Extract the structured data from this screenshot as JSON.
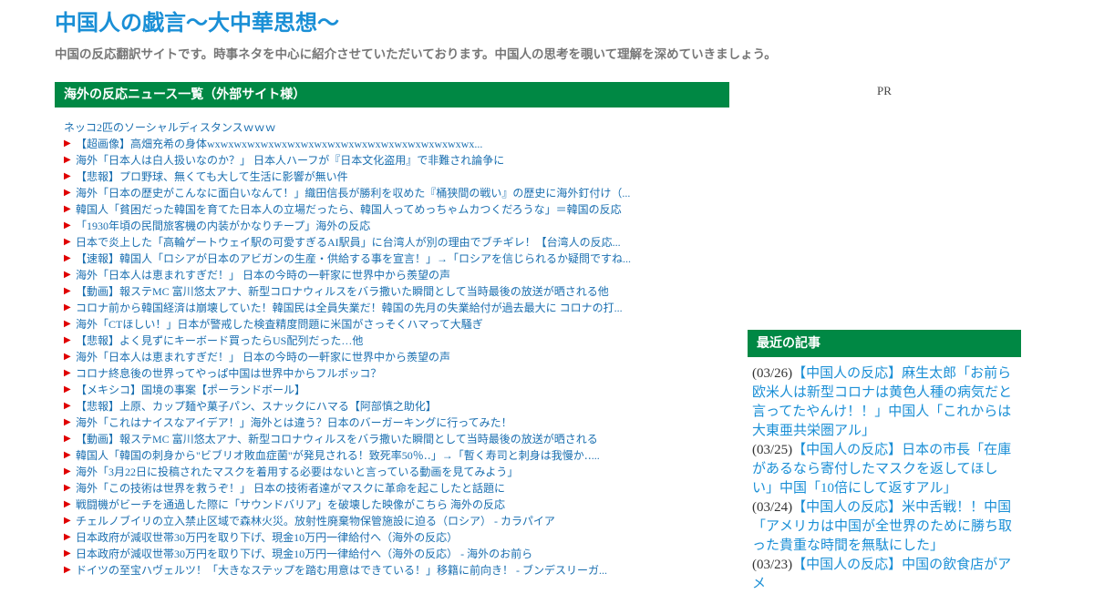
{
  "site": {
    "title": "中国人の戯言～大中華思想～",
    "description": "中国の反応翻訳サイトです。時事ネタを中心に紹介させていただいております。中国人の思考を覗いて理解を深めていきましょう。"
  },
  "news_widget": {
    "header": "海外の反応ニュース一覧（外部サイト様）",
    "items": [
      {
        "arrow": false,
        "text": "ネッコ2匹のソーシャルディスタンスｗｗｗ"
      },
      {
        "arrow": true,
        "text": "【超画像】高畑充希の身体wxwxwxwxwxwxwxwxwxwxwxwxwxwxwxwxwxwxwxwx..."
      },
      {
        "arrow": true,
        "text": "海外「日本人は白人扱いなのか？」 日本人ハーフが『日本文化盗用』で非難され論争に"
      },
      {
        "arrow": true,
        "text": "【悲報】プロ野球、無くても大して生活に影響が無い件"
      },
      {
        "arrow": true,
        "text": "海外「日本の歴史がこんなに面白いなんて！」織田信長が勝利を収めた『桶狭間の戦い』の歴史に海外釘付け（..."
      },
      {
        "arrow": true,
        "text": "韓国人「貧困だった韓国を育てた日本人の立場だったら、韓国人ってめっちゃムカつくだろうな」＝韓国の反応"
      },
      {
        "arrow": true,
        "text": "「1930年頃の民間旅客機の内装がかなりチープ」海外の反応"
      },
      {
        "arrow": true,
        "text": "日本で炎上した「高輪ゲートウェイ駅の可愛すぎるAI駅員」に台湾人が別の理由でブチギレ！【台湾人の反応..."
      },
      {
        "arrow": true,
        "text": "【速報】韓国人「ロシアが日本のアビガンの生産・供給する事を宣言！」→「ロシアを信じられるか疑問ですね..."
      },
      {
        "arrow": true,
        "text": "海外「日本人は恵まれすぎだ！」 日本の今時の一軒家に世界中から羨望の声"
      },
      {
        "arrow": true,
        "text": "【動画】報ステMC 富川悠太アナ、新型コロナウィルスをバラ撒いた瞬間として当時最後の放送が晒される他"
      },
      {
        "arrow": true,
        "text": "コロナ前から韓国経済は崩壊していた！韓国民は全員失業だ！韓国の先月の失業給付が過去最大に コロナの打..."
      },
      {
        "arrow": true,
        "text": "海外「CTほしい！」日本が警戒した検査精度問題に米国がさっそくハマって大騒ぎ"
      },
      {
        "arrow": true,
        "text": "【悲報】よく見ずにキーボード買ったらUS配列だった…他"
      },
      {
        "arrow": true,
        "text": "海外「日本人は恵まれすぎだ！」 日本の今時の一軒家に世界中から羨望の声"
      },
      {
        "arrow": true,
        "text": "コロナ終息後の世界ってやっぱ中国は世界中からフルボッコ？"
      },
      {
        "arrow": true,
        "text": "【メキシコ】国境の事案【ポーランドボール】"
      },
      {
        "arrow": true,
        "text": "【悲報】上原、カップ麺や菓子パン、スナックにハマる【阿部慎之助化】"
      },
      {
        "arrow": true,
        "text": "海外「これはナイスなアイデア！」海外とは違う？日本のバーガーキングに行ってみた！"
      },
      {
        "arrow": true,
        "text": "【動画】報ステMC 富川悠太アナ、新型コロナウィルスをバラ撒いた瞬間として当時最後の放送が晒される"
      },
      {
        "arrow": true,
        "text": "韓国人「韓国の刺身から\"ビブリオ敗血症菌\"が発見される！致死率50％‥」→「暫く寿司と刺身は我慢か‥..."
      },
      {
        "arrow": true,
        "text": "海外「3月22日に投稿されたマスクを着用する必要はないと言っている動画を見てみよう」"
      },
      {
        "arrow": true,
        "text": "海外「この技術は世界を救うぞ！」 日本の技術者達がマスクに革命を起こしたと話題に"
      },
      {
        "arrow": true,
        "text": "戦闘機がビーチを通過した際に「サウンドバリア」を破壊した映像がこちら 海外の反応"
      },
      {
        "arrow": true,
        "text": "チェルノブイリの立入禁止区域で森林火災。放射性廃棄物保管施設に迫る（ロシア） - カラパイア"
      },
      {
        "arrow": true,
        "text": "日本政府が減収世帯30万円を取り下げ、現金10万円一律給付へ（海外の反応）"
      },
      {
        "arrow": true,
        "text": "日本政府が減収世帯30万円を取り下げ、現金10万円一律給付へ（海外の反応） - 海外のお前ら"
      },
      {
        "arrow": true,
        "text": "ドイツの至宝ハヴェルツ！「大きなステップを踏む用意はできている！」移籍に前向き！ - ブンデスリーガ..."
      }
    ]
  },
  "pr": {
    "label": "PR"
  },
  "recent_widget": {
    "header": "最近の記事",
    "items": [
      {
        "date": "(03/26)",
        "title": "【中国人の反応】麻生太郎「お前ら欧米人は新型コロナは黄色人種の病気だと言ってたやんけ！！」中国人「これからは大東亜共栄圏アル」"
      },
      {
        "date": "(03/25)",
        "title": "【中国人の反応】日本の市長「在庫があるなら寄付したマスクを返してほしい」中国「10倍にして返すアル」"
      },
      {
        "date": "(03/24)",
        "title": "【中国人の反応】米中舌戦！！中国「アメリカは中国が全世界のために勝ち取った貴重な時間を無駄にした」"
      },
      {
        "date": "(03/23)",
        "title": "【中国人の反応】中国の飲食店がアメ"
      }
    ]
  },
  "colors": {
    "title_blue": "#1a8fd6",
    "header_green": "#008844",
    "arrow_red": "#e00000",
    "link_blue": "#1a6fb0"
  }
}
